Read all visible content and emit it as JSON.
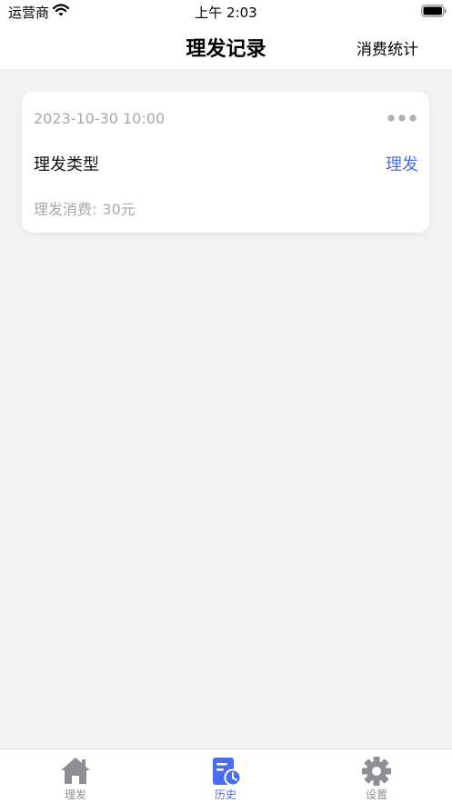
{
  "status_bar": {
    "carrier": "运营商",
    "time": "上午 2:03"
  },
  "nav": {
    "title": "理发记录",
    "action_label": "消费统计"
  },
  "record": {
    "datetime": "2023-10-30 10:00",
    "type_label": "理发类型",
    "type_value": "理发",
    "cost_label": "理发消费:",
    "cost_value": "30元"
  },
  "tabs": [
    {
      "label": "理发",
      "icon": "house-icon",
      "active": false
    },
    {
      "label": "历史",
      "icon": "history-icon",
      "active": true
    },
    {
      "label": "设置",
      "icon": "gear-icon",
      "active": false
    }
  ],
  "colors": {
    "accent": "#4a6cf0",
    "muted_text": "#a8a8ac",
    "background": "#f3f3f4",
    "inactive_icon": "#8e8e93"
  }
}
